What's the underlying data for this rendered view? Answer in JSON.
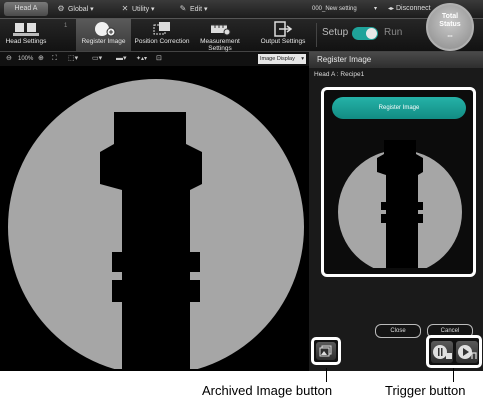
{
  "menubar": {
    "head_tab": "Head A",
    "global": "Global",
    "utility": "Utility",
    "edit": "Edit",
    "setting": "000_New setting",
    "disconnect": "Disconnect"
  },
  "toolbar": {
    "step": "1",
    "head_settings": "Head Settings",
    "register_image": "Register Image",
    "position_correction": "Position Correction",
    "measurement_settings_1": "Measurement",
    "measurement_settings_2": "Settings",
    "output_settings": "Output Settings",
    "setup": "Setup",
    "run": "Run",
    "total_status_1": "Total",
    "total_status_2": "Status",
    "total_status_value": "--"
  },
  "image_bar": {
    "zoom": "100%",
    "image_display": "Image Display"
  },
  "panel": {
    "title": "Register Image",
    "recipe": "Head A : Recipe1",
    "register_button": "Register Image",
    "close": "Close",
    "cancel": "Cancel"
  },
  "captions": {
    "archived": "Archived Image button",
    "trigger": "Trigger button"
  },
  "colors": {
    "accent": "#1fa39a",
    "part_gray": "#a6a6a6",
    "background": "#000000"
  }
}
